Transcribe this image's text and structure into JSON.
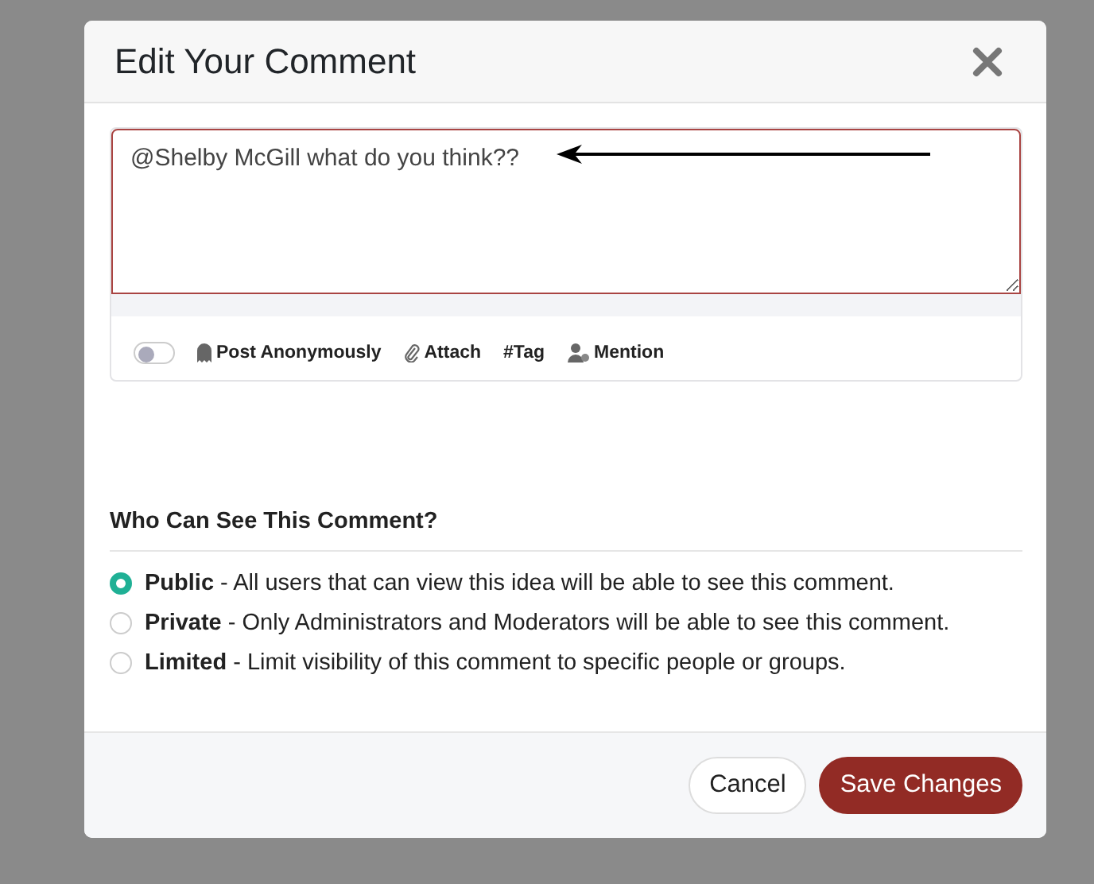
{
  "dialog": {
    "title": "Edit Your Comment"
  },
  "comment": {
    "value": "@Shelby McGill what do you think??"
  },
  "toolbar": {
    "anonymous_toggle": {
      "on": false
    },
    "items": [
      {
        "kind": "anonymous",
        "label": "Post Anonymously"
      },
      {
        "kind": "attach",
        "label": "Attach"
      },
      {
        "kind": "tag",
        "label": "#Tag"
      },
      {
        "kind": "mention",
        "label": "Mention"
      }
    ]
  },
  "visibility": {
    "title": "Who Can See This Comment?",
    "options": [
      {
        "text": "**Public** - All users that can view this idea will be able to see this comment.",
        "selected": true
      },
      {
        "text": "**Private** - Only Administrators and Moderators will be able to see this comment.",
        "selected": false
      },
      {
        "text": "**Limited** - Limit visibility of this comment to specific people or groups.",
        "selected": false
      }
    ]
  },
  "buttons": [
    {
      "kind": "secondary",
      "label": "Cancel"
    },
    {
      "kind": "primary",
      "label": "Save Changes"
    }
  ]
}
